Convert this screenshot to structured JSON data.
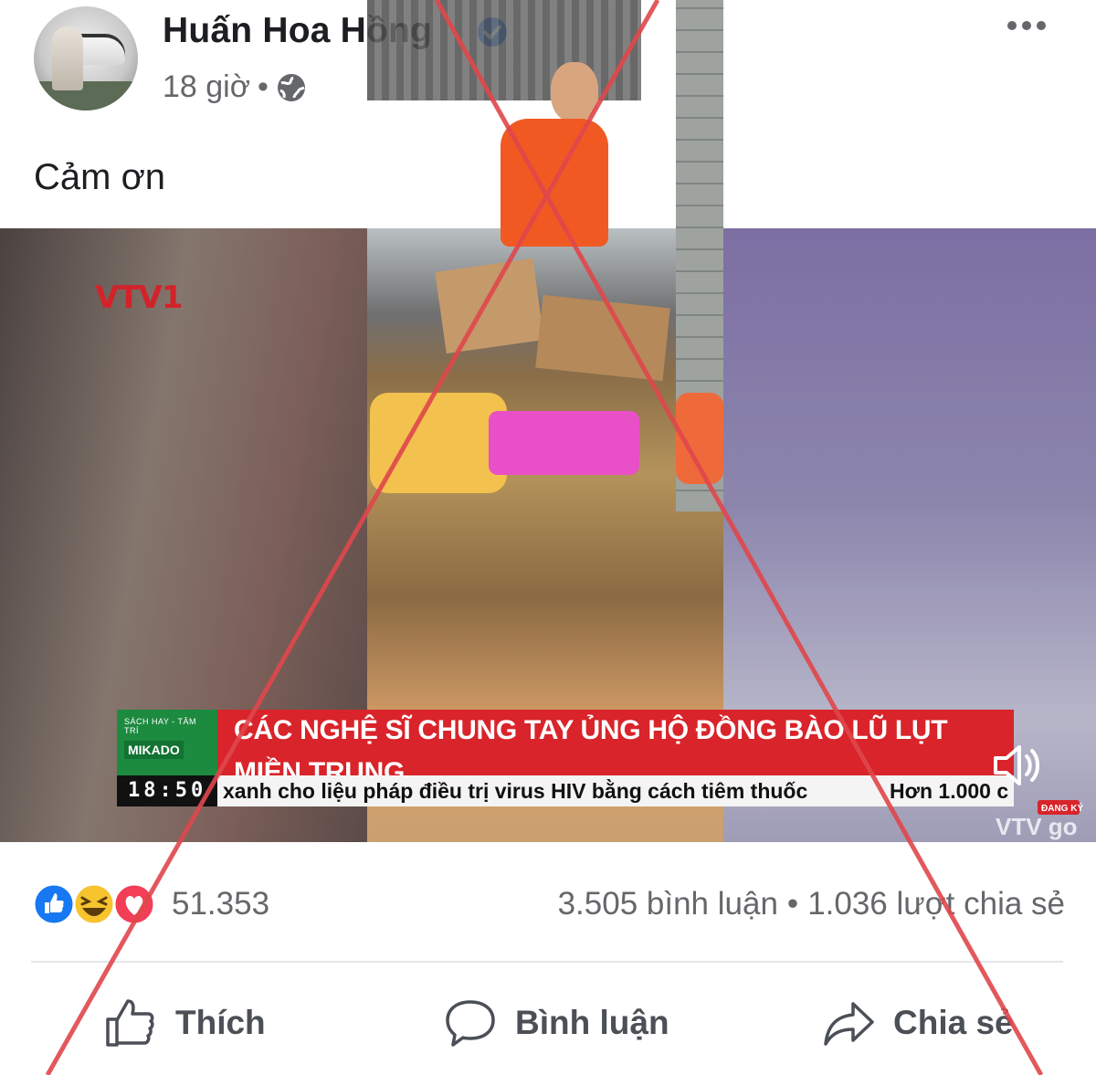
{
  "post": {
    "author_name": "Huấn Hoa Hồng",
    "timestamp": "18 giờ",
    "dot": "•",
    "caption": "Cảm ơn",
    "audience_icon": "globe-icon",
    "more_icon": "more-options-icon"
  },
  "video": {
    "channel_logo": "VTV1",
    "panel_top": "SÁCH HAY - TÂM TRÍ",
    "panel_logo": "MIKADO",
    "headline": "CÁC NGHỆ SĨ CHUNG TAY ỦNG HỘ ĐỒNG BÀO LŨ LỤT MIỀN TRUNG",
    "clock": "18:50",
    "ticker_main": "xanh cho liệu pháp điều trị virus HIV bằng cách tiêm thuốc",
    "ticker_next": "Hơn 1.000 c",
    "watermark": "VTV go",
    "watermark_badge": "ĐANG KÝ"
  },
  "stats": {
    "reactions_count": "51.353",
    "comments": "3.505 bình luận",
    "separator": "•",
    "shares": "1.036 lượt chia sẻ"
  },
  "actions": {
    "like_label": "Thích",
    "comment_label": "Bình luận",
    "share_label": "Chia sẻ"
  },
  "colors": {
    "verified_blue": "#1877f2",
    "text_secondary": "#65676b",
    "headline_red": "#d8242a",
    "x_overlay_red": "#e0474c"
  }
}
